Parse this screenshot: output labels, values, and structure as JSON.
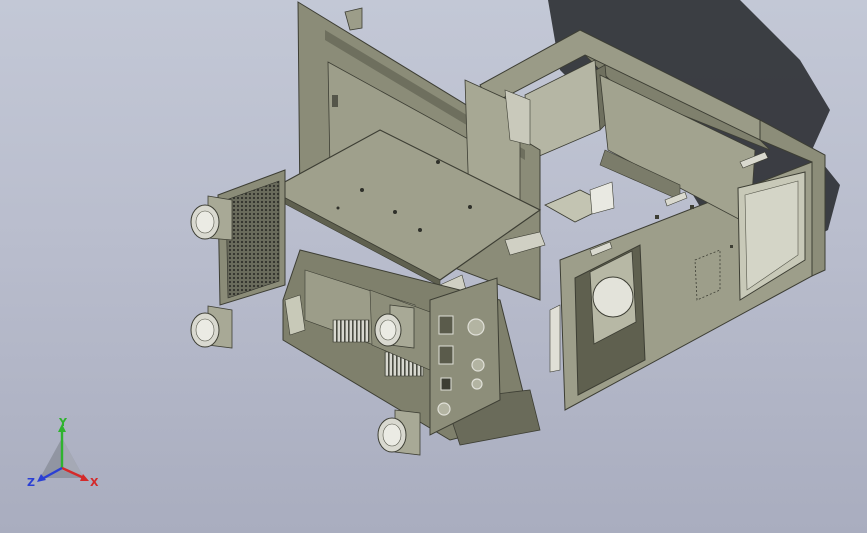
{
  "viewport": {
    "background_top": "#c3c8d6",
    "background_bottom": "#a9adbf"
  },
  "model": {
    "part_color": "#8f907c",
    "part_dark": "#5f604f",
    "part_light": "#b3b4a2",
    "shadow_color": "#2c2f33"
  },
  "triad": {
    "x_label": "X",
    "y_label": "Y",
    "z_label": "Z",
    "x_color": "#d42a2a",
    "y_color": "#2fb32f",
    "z_color": "#2a3fd4"
  }
}
